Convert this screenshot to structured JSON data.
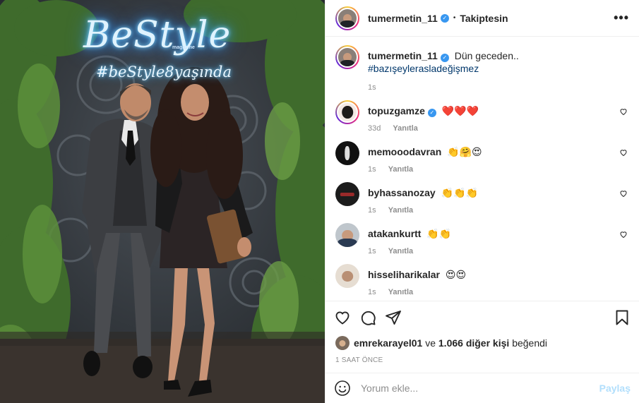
{
  "post": {
    "author": "tumermetin_11",
    "follow_status": "Takiptesin",
    "more_label": "•••"
  },
  "photo": {
    "neon_title": "BeStyle",
    "neon_small": "magazine",
    "neon_sub": "#beStyle8yaşında"
  },
  "caption": {
    "user": "tumermetin_11",
    "text": "Dün geceden..",
    "hashtag": "#bazışeylerasladeğişmez",
    "time": "1s"
  },
  "comments": [
    {
      "user": "topuzgamze",
      "verified": true,
      "text": "❤️❤️❤️",
      "time": "33d",
      "reply": "Yanıtla"
    },
    {
      "user": "memooodavran",
      "verified": false,
      "text": "👏🤗😍",
      "time": "1s",
      "reply": "Yanıtla"
    },
    {
      "user": "byhassanozay",
      "verified": false,
      "text": "👏👏👏",
      "time": "1s",
      "reply": "Yanıtla"
    },
    {
      "user": "atakankurtt",
      "verified": false,
      "text": "👏👏",
      "time": "1s",
      "reply": "Yanıtla"
    },
    {
      "user": "hisseliharikalar",
      "verified": false,
      "text": "😍😍",
      "time": "1s",
      "reply": "Yanıtla"
    }
  ],
  "likes": {
    "first_user": "emrekarayel01",
    "connector": "ve",
    "others": "1.066 diğer kişi",
    "suffix": "beğendi"
  },
  "timestamp": "1 SAAT ÖNCE",
  "add_comment": {
    "placeholder": "Yorum ekle...",
    "share_label": "Paylaş"
  },
  "icons": [
    "heart-icon",
    "comment-icon",
    "share-icon",
    "bookmark-icon",
    "emoji-icon",
    "more-icon",
    "verified-icon"
  ],
  "colors": {
    "verified": "#3897f0",
    "link": "#00376b",
    "share_disabled": "#b2dffc",
    "muted": "#8e8e8e"
  }
}
